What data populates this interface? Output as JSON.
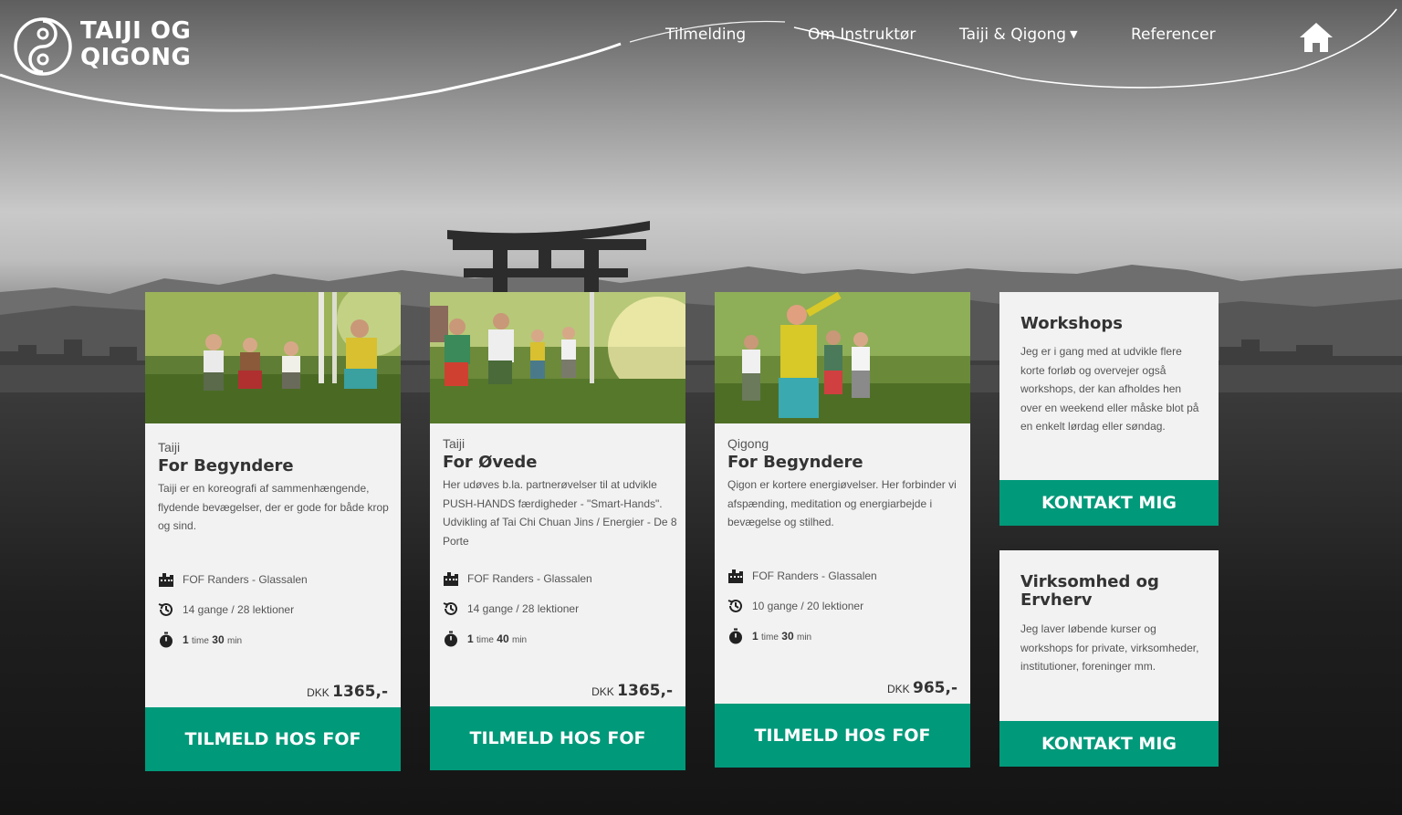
{
  "brand": {
    "logo_line1": "TAIJI OG",
    "logo_line2": "QIGONG"
  },
  "nav": {
    "items": [
      {
        "label": "Tilmelding"
      },
      {
        "label": "Om Instruktør"
      },
      {
        "label": "Taiji & Qigong",
        "caret": "▼"
      },
      {
        "label": "Referencer"
      }
    ],
    "home_icon": "home-icon"
  },
  "courses": [
    {
      "category": "Taiji",
      "title": "For Begyndere",
      "description": "Taiji er en koreografi af sammenhængende, flydende bevægelser, der er gode for både krop og sind.",
      "location": "FOF Randers - Glassalen",
      "sessions": "14 gange / 28 lektioner",
      "duration_hours": "1",
      "duration_hours_unit": "time",
      "duration_minutes": "30",
      "duration_minutes_unit": "min",
      "currency": "DKK",
      "price": "1365,-",
      "cta": "TILMELD HOS FOF"
    },
    {
      "category": "Taiji",
      "title": "For Øvede",
      "description": "Her udøves b.la. partnerøvelser til at udvikle PUSH-HANDS færdigheder - \"Smart-Hands\". Udvikling af Tai Chi Chuan Jins / Energier - De 8 Porte",
      "location": "FOF Randers - Glassalen",
      "sessions": "14 gange / 28 lektioner",
      "duration_hours": "1",
      "duration_hours_unit": "time",
      "duration_minutes": "40",
      "duration_minutes_unit": "min",
      "currency": "DKK",
      "price": "1365,-",
      "cta": "TILMELD HOS FOF"
    },
    {
      "category": "Qigong",
      "title": "For Begyndere",
      "description": "Qigon er kortere energiøvelser. Her forbinder vi afspænding, meditation og energiarbejde i bevægelse og stilhed.",
      "location": "FOF Randers - Glassalen",
      "sessions": "10 gange / 20 lektioner",
      "duration_hours": "1",
      "duration_hours_unit": "time",
      "duration_minutes": "30",
      "duration_minutes_unit": "min",
      "currency": "DKK",
      "price": "965,-",
      "cta": "TILMELD HOS FOF"
    }
  ],
  "side": [
    {
      "title": "Workshops",
      "description": "Jeg er i gang med at udvikle flere korte forløb og overvejer også workshops, der kan afholdes hen over en weekend eller måske blot på en enkelt lørdag eller søndag.",
      "cta": "KONTAKT MIG"
    },
    {
      "title": "Virksomhed og Ervherv",
      "description": "Jeg laver løbende kurser og workshops for private, virksomheder, institutioner, foreninger mm.",
      "cta": "KONTAKT MIG"
    }
  ],
  "colors": {
    "accent": "#00997a",
    "card_bg": "#f2f2f2"
  }
}
